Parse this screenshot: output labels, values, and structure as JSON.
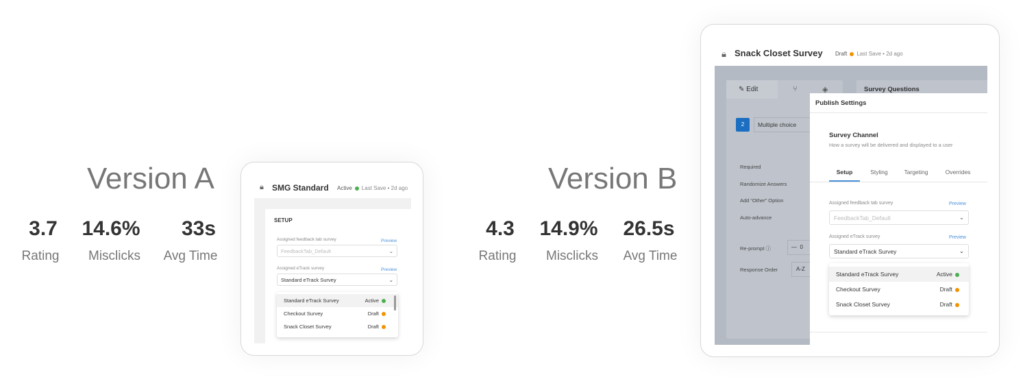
{
  "versions": [
    {
      "title": "Version A",
      "stats": [
        {
          "value": "3.7",
          "label": "Rating"
        },
        {
          "value": "14.6%",
          "label": "Misclicks"
        },
        {
          "value": "33s",
          "label": "Avg Time"
        }
      ]
    },
    {
      "title": "Version B",
      "stats": [
        {
          "value": "4.3",
          "label": "Rating"
        },
        {
          "value": "14.9%",
          "label": "Misclicks"
        },
        {
          "value": "26.5s",
          "label": "Avg Time"
        }
      ]
    }
  ],
  "colors": {
    "active": "#4caf50",
    "draft": "#f39200",
    "accent": "#1b6ec2",
    "link": "#4a90d9"
  },
  "cardA": {
    "title": "SMG Standard",
    "status": "Active",
    "last_save": "Last Save",
    "sep": "•",
    "ago": "2d ago",
    "section": "SETUP",
    "feedback_label": "Assigned feedback tab survey",
    "feedback_value": "FeedbackTab_Default",
    "etrack_label": "Assigned eTrack survey",
    "etrack_value": "Standard eTrack Survey",
    "preview": "Preview",
    "options": [
      {
        "name": "Standard eTrack Survey",
        "status": "Active"
      },
      {
        "name": "Checkout Survey",
        "status": "Draft"
      },
      {
        "name": "Snack Closet Survey",
        "status": "Draft"
      }
    ]
  },
  "cardB": {
    "title": "Snack Closet Survey",
    "status": "Draft",
    "last_save": "Last Save",
    "sep": "•",
    "ago": "2d ago",
    "edit_tab": "Edit",
    "survey_questions": "Survey Questions",
    "question_number": "2",
    "question_type": "Multiple choice",
    "settings": [
      "Required",
      "Randomize Answers",
      "Add “Other” Option",
      "Auto-advance"
    ],
    "reprompt": "Re-prompt",
    "reprompt_value": "0",
    "response_order": "Response Order",
    "response_order_value": "A-Z",
    "modal_title": "Publish Settings",
    "channel_title": "Survey Channel",
    "channel_desc": "How a survey will be delivered and displayed to a user",
    "tabs": [
      "Setup",
      "Styling",
      "Targeting",
      "Overrides"
    ],
    "feedback_label": "Assigned feedback tab survey",
    "feedback_value": "FeedbackTab_Default",
    "etrack_label": "Assigned eTrack survey",
    "etrack_value": "Standard eTrack Survey",
    "preview": "Preview",
    "options": [
      {
        "name": "Standard eTrack Survey",
        "status": "Active"
      },
      {
        "name": "Checkout Survey",
        "status": "Draft"
      },
      {
        "name": "Snack Closet Survey",
        "status": "Draft"
      }
    ]
  }
}
